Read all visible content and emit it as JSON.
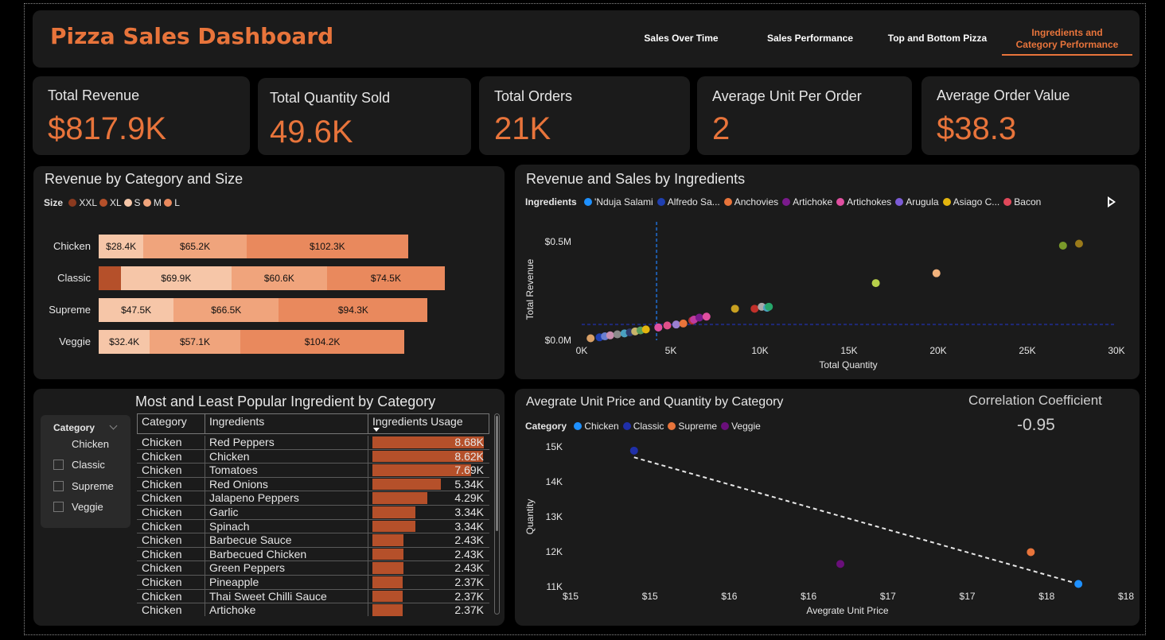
{
  "header": {
    "title": "Pizza Sales Dashboard",
    "tabs": [
      {
        "label": "Sales Over Time",
        "active": false
      },
      {
        "label": "Sales Performance",
        "active": false
      },
      {
        "label": "Top and Bottom Pizza",
        "active": false
      },
      {
        "label": "Ingredients and\nCategory Performance",
        "active": true
      }
    ]
  },
  "kpis": [
    {
      "label": "Total Revenue",
      "value": "$817.9K"
    },
    {
      "label": "Total Quantity Sold",
      "value": "49.6K"
    },
    {
      "label": "Total Orders",
      "value": "21K"
    },
    {
      "label": "Average Unit Per Order",
      "value": "2"
    },
    {
      "label": "Average Order Value",
      "value": "$38.3"
    }
  ],
  "colors": {
    "accent": "#e8743b",
    "size_xxl": "#8b3a1f",
    "size_xl": "#b5502a",
    "size_s": "#f6c6a8",
    "size_m": "#f0a47c",
    "size_l": "#e9895d"
  },
  "revenue_by_category": {
    "title": "Revenue by Category and Size",
    "legend_title": "Size",
    "legend": [
      "XXL",
      "XL",
      "S",
      "M",
      "L"
    ],
    "rows": [
      {
        "category": "Chicken",
        "segments": [
          {
            "size": "S",
            "label": "$28.4K",
            "value": 28.4
          },
          {
            "size": "M",
            "label": "$65.2K",
            "value": 65.2
          },
          {
            "size": "L",
            "label": "$102.3K",
            "value": 102.3
          }
        ]
      },
      {
        "category": "Classic",
        "segments": [
          {
            "size": "XL",
            "label": "",
            "value": 14.1
          },
          {
            "size": "S",
            "label": "$69.9K",
            "value": 69.9
          },
          {
            "size": "M",
            "label": "$60.6K",
            "value": 60.6
          },
          {
            "size": "L",
            "label": "$74.5K",
            "value": 74.5
          }
        ]
      },
      {
        "category": "Supreme",
        "segments": [
          {
            "size": "S",
            "label": "$47.5K",
            "value": 47.5
          },
          {
            "size": "M",
            "label": "$66.5K",
            "value": 66.5
          },
          {
            "size": "L",
            "label": "$94.3K",
            "value": 94.3
          }
        ]
      },
      {
        "category": "Veggie",
        "segments": [
          {
            "size": "S",
            "label": "$32.4K",
            "value": 32.4
          },
          {
            "size": "M",
            "label": "$57.1K",
            "value": 57.1
          },
          {
            "size": "L",
            "label": "$104.2K",
            "value": 104.2
          }
        ]
      }
    ]
  },
  "chart_data": [
    {
      "type": "scatter",
      "title": "Revenue and Sales by Ingredients",
      "legend_title": "Ingredients",
      "legend": [
        {
          "name": "'Nduja Salami",
          "color": "#1e90ff"
        },
        {
          "name": "Alfredo Sa...",
          "color": "#1f3fb0"
        },
        {
          "name": "Anchovies",
          "color": "#e8743b"
        },
        {
          "name": "Artichoke",
          "color": "#7a1a8c"
        },
        {
          "name": "Artichokes",
          "color": "#e04fa0"
        },
        {
          "name": "Arugula",
          "color": "#7b5bd6"
        },
        {
          "name": "Asiago C...",
          "color": "#e3b50e"
        },
        {
          "name": "Bacon",
          "color": "#e0485a"
        }
      ],
      "xlabel": "Total Quantity",
      "ylabel": "Total Revenue",
      "xticks": [
        "0K",
        "5K",
        "10K",
        "15K",
        "20K",
        "25K",
        "30K"
      ],
      "yticks": [
        "$0.0M",
        "$0.5M"
      ],
      "xlim": [
        0,
        30000
      ],
      "ylim": [
        0,
        0.5
      ],
      "ref_x": 4200,
      "ref_y": 0.08,
      "points": [
        {
          "x": 500,
          "y": 0.01,
          "color": "#d9a066"
        },
        {
          "x": 1000,
          "y": 0.015,
          "color": "#1f3fb0"
        },
        {
          "x": 1300,
          "y": 0.02,
          "color": "#6a7fd0"
        },
        {
          "x": 1600,
          "y": 0.025,
          "color": "#c98fb0"
        },
        {
          "x": 2000,
          "y": 0.03,
          "color": "#8b8b8b"
        },
        {
          "x": 2400,
          "y": 0.035,
          "color": "#4aa0c0"
        },
        {
          "x": 2700,
          "y": 0.04,
          "color": "#2d3a6e"
        },
        {
          "x": 3000,
          "y": 0.045,
          "color": "#c8b46a"
        },
        {
          "x": 3300,
          "y": 0.05,
          "color": "#5a9f5a"
        },
        {
          "x": 3600,
          "y": 0.055,
          "color": "#e3b50e"
        },
        {
          "x": 4300,
          "y": 0.065,
          "color": "#7b5bd6"
        },
        {
          "x": 4300,
          "y": 0.065,
          "color": "#e04fa0"
        },
        {
          "x": 4800,
          "y": 0.075,
          "color": "#e04f8a"
        },
        {
          "x": 5300,
          "y": 0.08,
          "color": "#9a7fd0"
        },
        {
          "x": 5700,
          "y": 0.085,
          "color": "#e8743b"
        },
        {
          "x": 6200,
          "y": 0.1,
          "color": "#b23030"
        },
        {
          "x": 6300,
          "y": 0.105,
          "color": "#c03aa0"
        },
        {
          "x": 6600,
          "y": 0.115,
          "color": "#7a1a8c"
        },
        {
          "x": 7000,
          "y": 0.12,
          "color": "#e04fa0"
        },
        {
          "x": 8600,
          "y": 0.16,
          "color": "#c8a020"
        },
        {
          "x": 9700,
          "y": 0.16,
          "color": "#c0302a"
        },
        {
          "x": 10100,
          "y": 0.17,
          "color": "#a9a9a9"
        },
        {
          "x": 10400,
          "y": 0.165,
          "color": "#4aa0c0"
        },
        {
          "x": 10500,
          "y": 0.17,
          "color": "#26a66a"
        },
        {
          "x": 16500,
          "y": 0.29,
          "color": "#b8d04a"
        },
        {
          "x": 19900,
          "y": 0.34,
          "color": "#f2b27c"
        },
        {
          "x": 27000,
          "y": 0.48,
          "color": "#7a9a2a"
        },
        {
          "x": 27900,
          "y": 0.49,
          "color": "#9a7a1a"
        }
      ]
    },
    {
      "type": "scatter",
      "title": "Avegrate Unit Price and Quantity by Category",
      "legend_title": "Category",
      "xlabel": "Avegrate Unit Price",
      "ylabel": "Quantity",
      "xticks": [
        "$15",
        "$15",
        "$16",
        "$16",
        "$17",
        "$17",
        "$18",
        "$18"
      ],
      "yticks": [
        "15K",
        "14K",
        "13K",
        "12K",
        "11K"
      ],
      "xlim": [
        15.0,
        18.5
      ],
      "ylim": [
        11000,
        15000
      ],
      "series": [
        {
          "name": "Chicken",
          "color": "#1e90ff",
          "x": [
            18.2
          ],
          "y": [
            11080
          ]
        },
        {
          "name": "Classic",
          "color": "#1f2fa8",
          "x": [
            15.4
          ],
          "y": [
            14890
          ]
        },
        {
          "name": "Supreme",
          "color": "#e8743b",
          "x": [
            17.9
          ],
          "y": [
            11990
          ]
        },
        {
          "name": "Veggie",
          "color": "#6a0f7a",
          "x": [
            16.7
          ],
          "y": [
            11650
          ]
        }
      ],
      "trendline": {
        "x": [
          15.4,
          18.2
        ],
        "y": [
          14700,
          11080
        ]
      },
      "correlation_label": "Correlation Coefficient",
      "correlation_value": "-0.95"
    }
  ],
  "ingredients_table": {
    "title": "Most and Least Popular Ingredient by Category",
    "slicer_title": "Category",
    "slicer_items": [
      {
        "label": "Chicken",
        "checked": true
      },
      {
        "label": "Classic",
        "checked": false
      },
      {
        "label": "Supreme",
        "checked": false
      },
      {
        "label": "Veggie",
        "checked": false
      }
    ],
    "columns": [
      "Category",
      "Ingredients",
      "Ingredients Usage"
    ],
    "max_usage": 8.68,
    "rows": [
      {
        "category": "Chicken",
        "ingredient": "Red Peppers",
        "usage": "8.68K",
        "value": 8.68
      },
      {
        "category": "Chicken",
        "ingredient": "Chicken",
        "usage": "8.62K",
        "value": 8.62
      },
      {
        "category": "Chicken",
        "ingredient": "Tomatoes",
        "usage": "7.69K",
        "value": 7.69
      },
      {
        "category": "Chicken",
        "ingredient": "Red Onions",
        "usage": "5.34K",
        "value": 5.34
      },
      {
        "category": "Chicken",
        "ingredient": "Jalapeno Peppers",
        "usage": "4.29K",
        "value": 4.29
      },
      {
        "category": "Chicken",
        "ingredient": "Garlic",
        "usage": "3.34K",
        "value": 3.34
      },
      {
        "category": "Chicken",
        "ingredient": "Spinach",
        "usage": "3.34K",
        "value": 3.34
      },
      {
        "category": "Chicken",
        "ingredient": "Barbecue Sauce",
        "usage": "2.43K",
        "value": 2.43
      },
      {
        "category": "Chicken",
        "ingredient": "Barbecued Chicken",
        "usage": "2.43K",
        "value": 2.43
      },
      {
        "category": "Chicken",
        "ingredient": "Green Peppers",
        "usage": "2.43K",
        "value": 2.43
      },
      {
        "category": "Chicken",
        "ingredient": "Pineapple",
        "usage": "2.37K",
        "value": 2.37
      },
      {
        "category": "Chicken",
        "ingredient": "Thai Sweet Chilli Sauce",
        "usage": "2.37K",
        "value": 2.37
      },
      {
        "category": "Chicken",
        "ingredient": "Artichoke",
        "usage": "2.37K",
        "value": 2.37
      }
    ]
  }
}
